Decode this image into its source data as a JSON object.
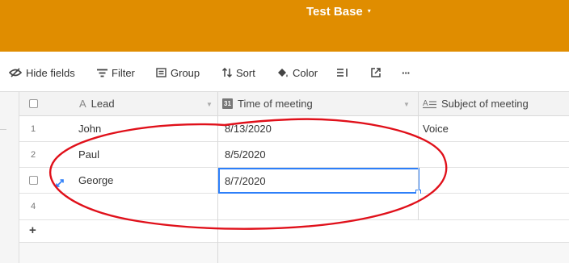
{
  "header": {
    "base_name": "Test Base",
    "caret": "▾",
    "background": "#e08d00"
  },
  "toolbar": {
    "hide_fields": "Hide fields",
    "filter": "Filter",
    "group": "Group",
    "sort": "Sort",
    "color": "Color",
    "more": "···"
  },
  "columns": [
    {
      "name": "Lead",
      "icon": "A"
    },
    {
      "name": "Time of meeting",
      "icon": "31"
    },
    {
      "name": "Subject of meeting",
      "icon": "long-text-icon"
    }
  ],
  "rows": [
    {
      "num": "1",
      "lead": "John",
      "time": "8/13/2020",
      "subject": "Voice"
    },
    {
      "num": "2",
      "lead": "Paul",
      "time": "8/5/2020",
      "subject": ""
    },
    {
      "num": "",
      "lead": "George",
      "time": "8/7/2020",
      "subject": ""
    },
    {
      "num": "4",
      "lead": "",
      "time": "",
      "subject": ""
    }
  ],
  "add_row": "+",
  "colors": {
    "accent": "#2d7ff9",
    "annotation": "#e0101a"
  }
}
